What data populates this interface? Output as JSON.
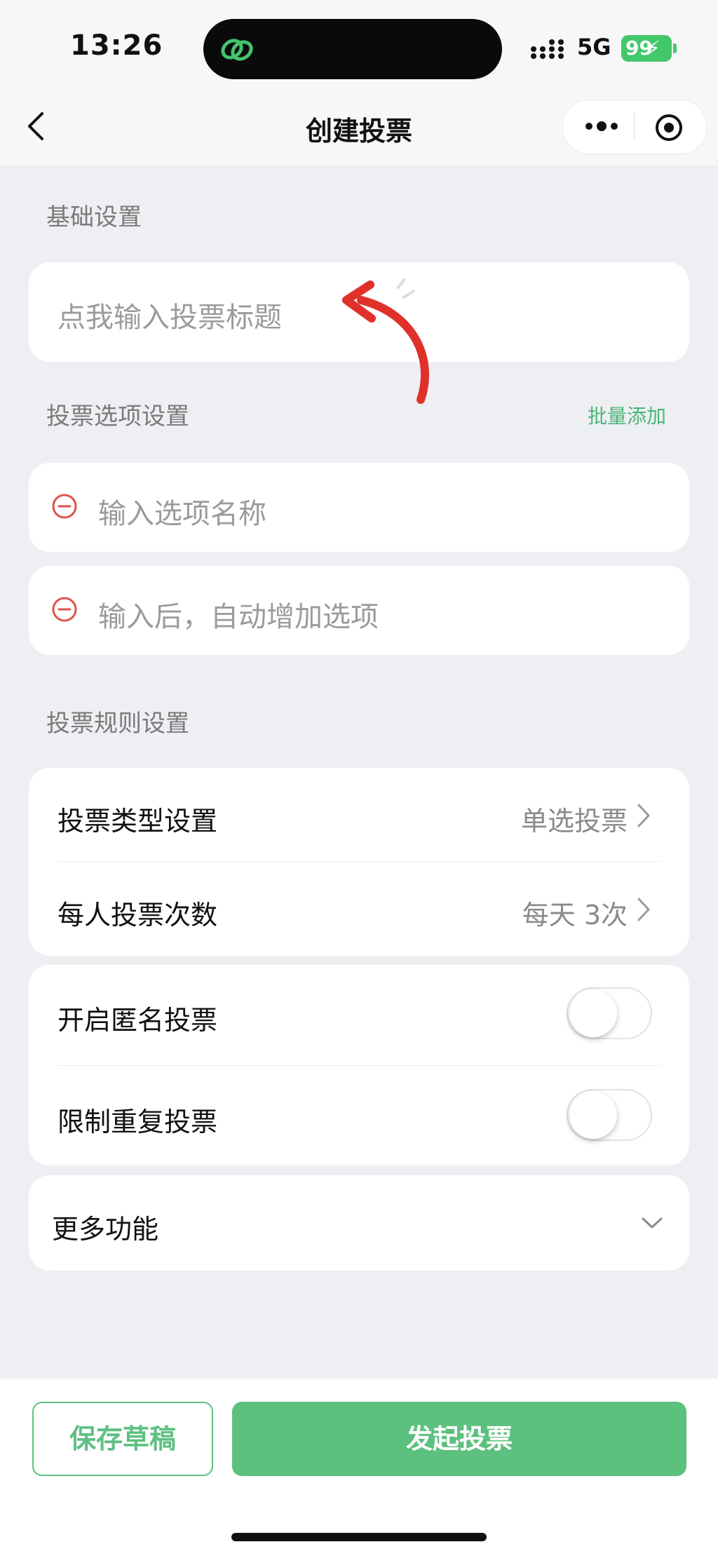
{
  "status_bar": {
    "time": "13:26",
    "network": "5G",
    "battery": "99"
  },
  "nav": {
    "title": "创建投票"
  },
  "basic": {
    "section_label": "基础设置",
    "title_placeholder": "点我输入投票标题"
  },
  "options": {
    "section_label": "投票选项设置",
    "batch_add_label": "批量添加",
    "items": [
      {
        "placeholder": "输入选项名称"
      },
      {
        "placeholder": "输入后，自动增加选项"
      }
    ]
  },
  "rules": {
    "section_label": "投票规则设置",
    "vote_type": {
      "label": "投票类型设置",
      "value": "单选投票"
    },
    "votes_per_person": {
      "label": "每人投票次数",
      "value": "每天 3次"
    },
    "anonymous": {
      "label": "开启匿名投票",
      "enabled": false
    },
    "limit_repeat": {
      "label": "限制重复投票",
      "enabled": false
    }
  },
  "more_features": {
    "label": "更多功能"
  },
  "actions": {
    "save_draft": "保存草稿",
    "submit": "发起投票"
  },
  "colors": {
    "brand_green": "#5cc07e",
    "danger_red": "#e0524a",
    "annotation_red": "#e0302a"
  }
}
